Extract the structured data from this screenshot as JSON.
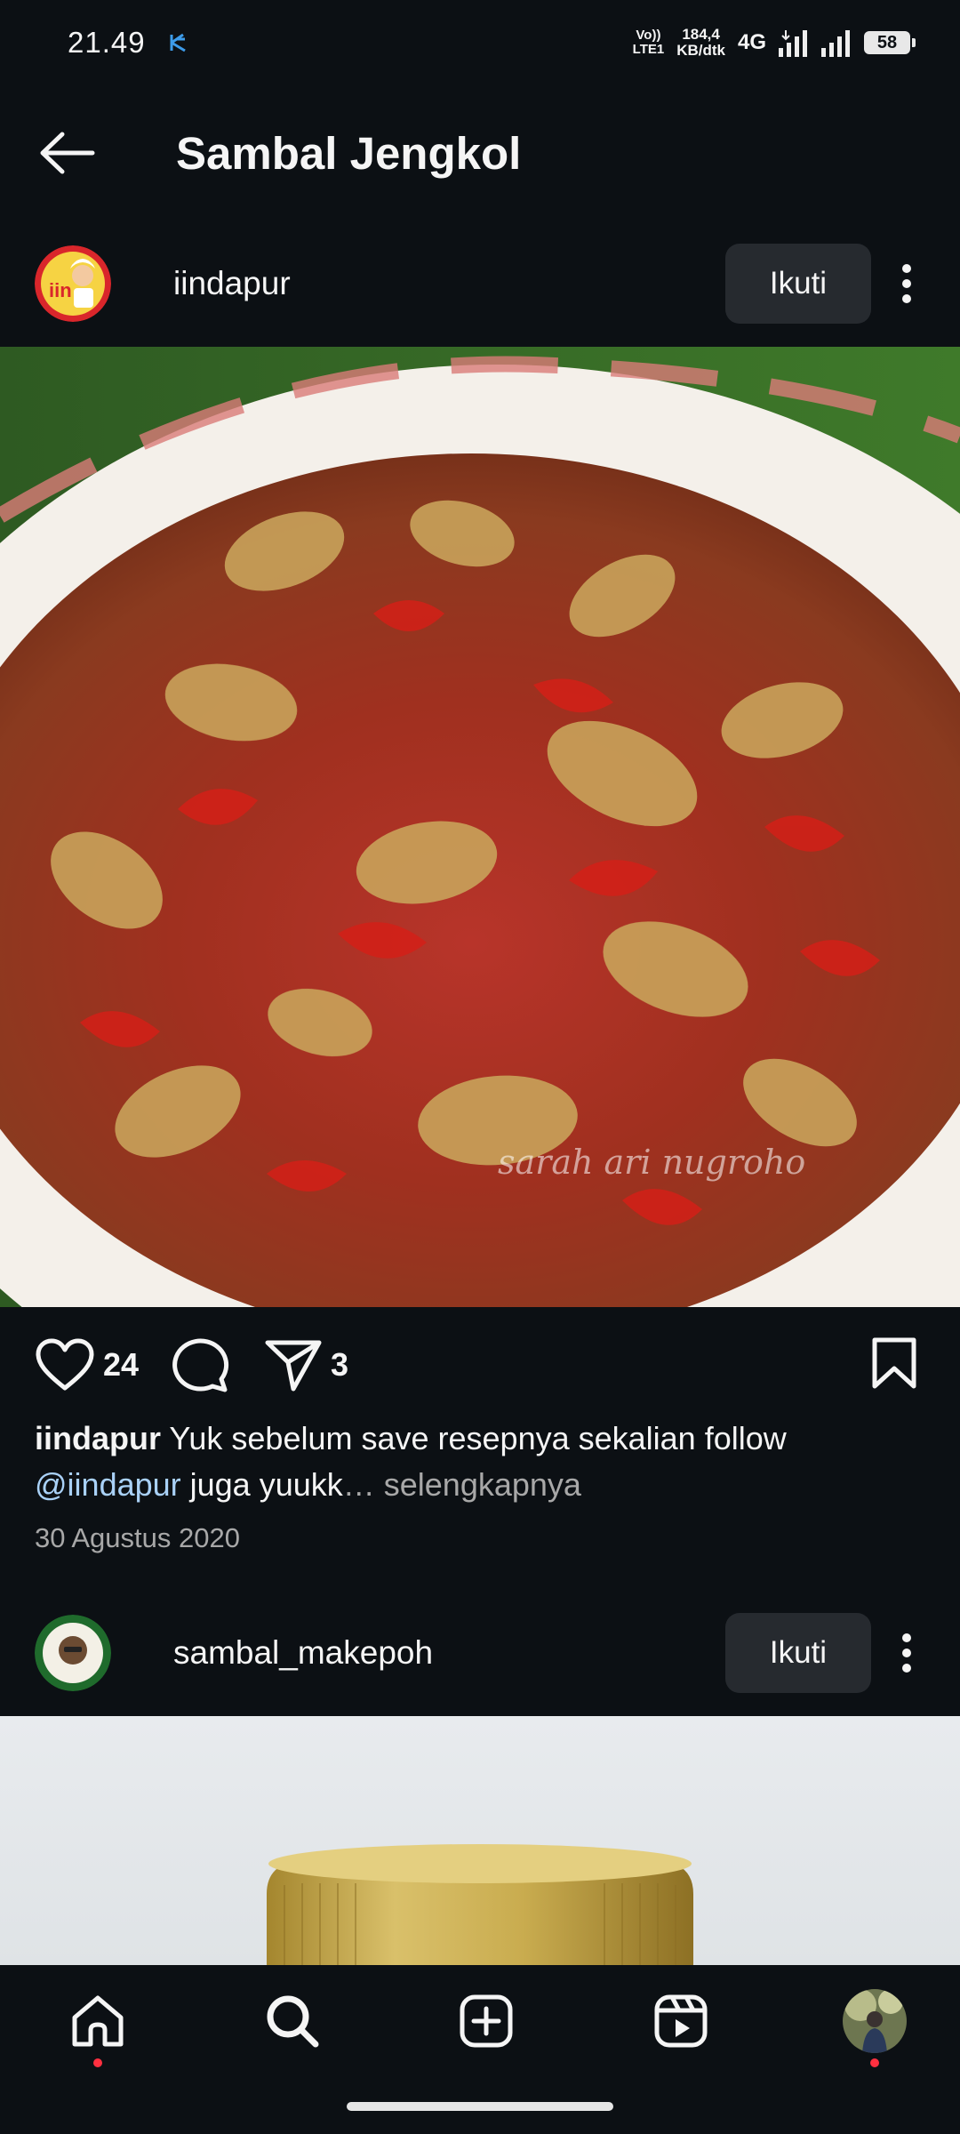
{
  "status_bar": {
    "time": "21.49",
    "volte_top": "Vo))",
    "volte_bottom": "LTE1",
    "netspeed_value": "184,4",
    "netspeed_unit": "KB/dtk",
    "network": "4G",
    "battery": "58"
  },
  "header": {
    "title": "Sambal Jengkol",
    "back_icon": "arrow-left-icon"
  },
  "post": {
    "username": "iindapur",
    "follow_label": "Ikuti",
    "avatar_text": "iin",
    "watermark": "sarah ari nugroho",
    "likes": "24",
    "shares": "3",
    "caption_user": "iindapur",
    "caption_text": " Yuk sebelum save resepnya sekalian follow ",
    "caption_mention": "@iindapur",
    "caption_rest": " juga yuukk",
    "caption_ellipsis": "…",
    "caption_more": " selengkapnya",
    "date": "30 Agustus 2020"
  },
  "post2": {
    "username": "sambal_makepoh",
    "follow_label": "Ikuti"
  },
  "nav": {
    "items": [
      "home-icon",
      "search-icon",
      "create-icon",
      "reels-icon",
      "profile-avatar"
    ]
  },
  "colors": {
    "background": "#0c1014",
    "button_bg": "#262a2f",
    "mention": "#a9d1f7",
    "notification_dot": "#ff3040"
  }
}
